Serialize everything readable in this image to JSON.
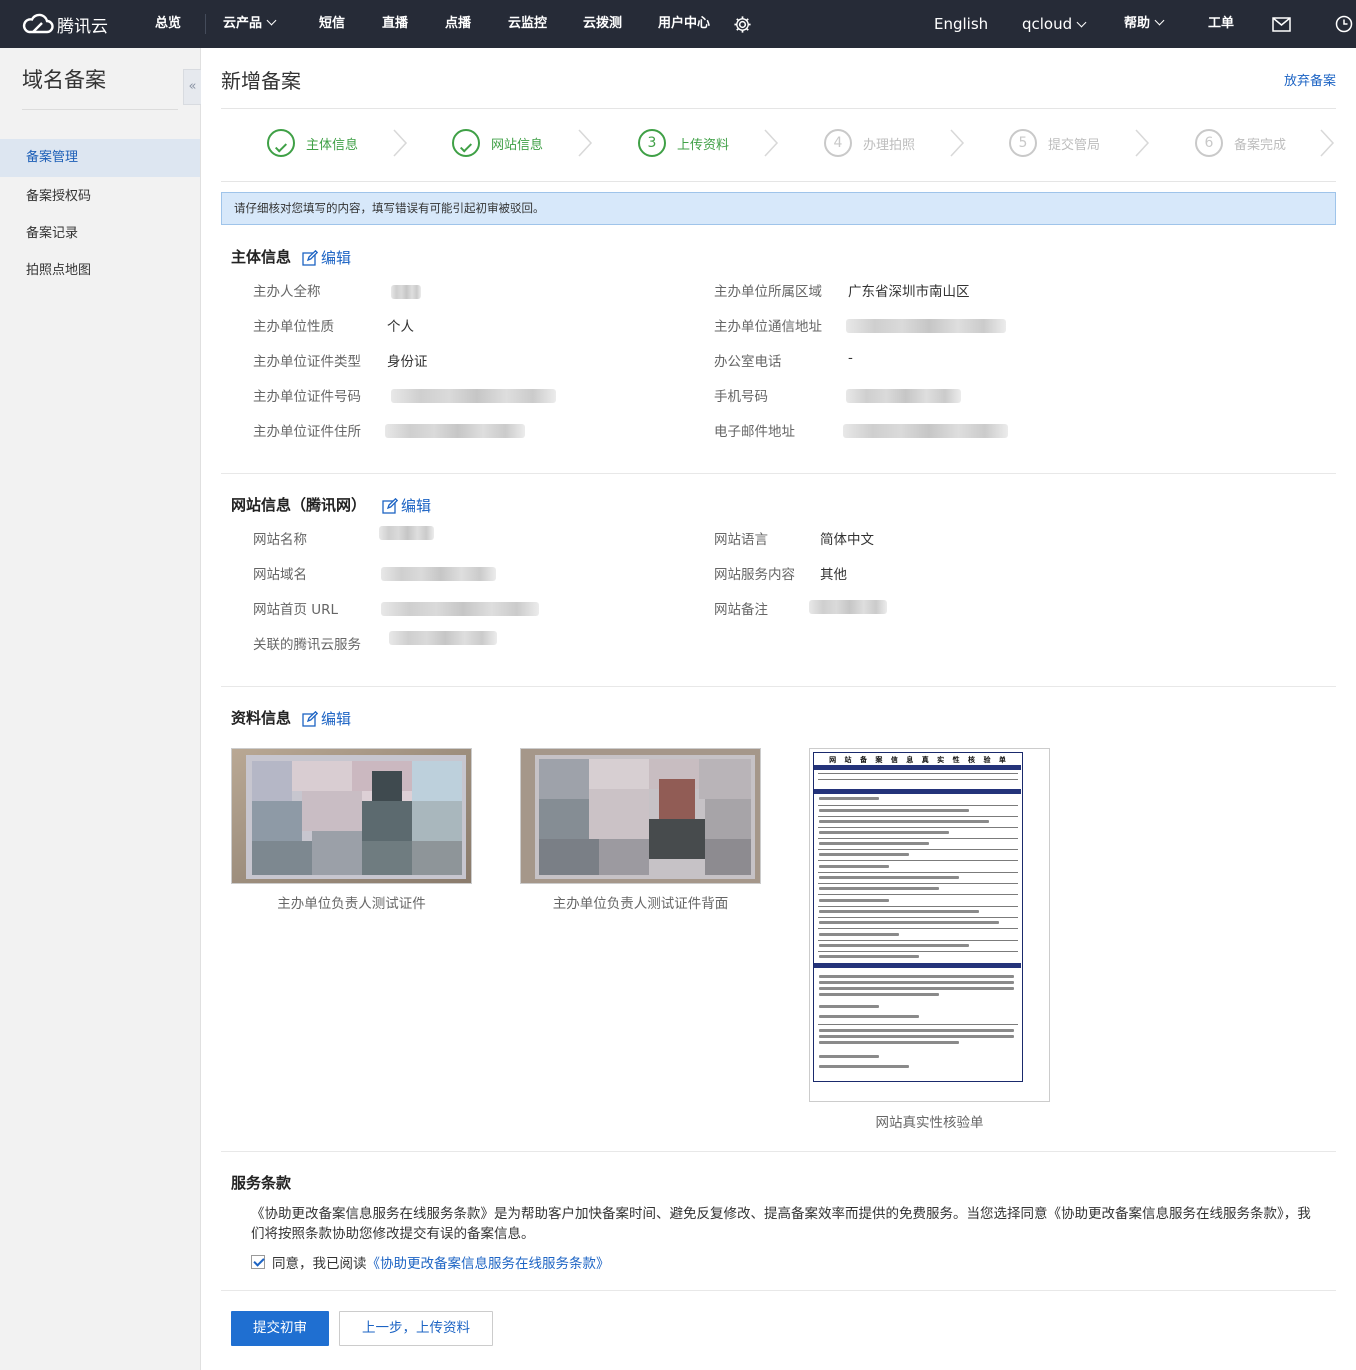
{
  "topnav": {
    "brand": "腾讯云",
    "items": [
      "总览",
      "云产品",
      "短信",
      "直播",
      "点播",
      "云监控",
      "云拨测",
      "用户中心"
    ],
    "right": {
      "language": "English",
      "account": "qcloud",
      "help": "帮助",
      "ticket": "工单"
    }
  },
  "sidebar": {
    "title": "域名备案",
    "collapse": "«",
    "items": [
      "备案管理",
      "备案授权码",
      "备案记录",
      "拍照点地图"
    ]
  },
  "page": {
    "title": "新增备案",
    "abandon": "放弃备案"
  },
  "steps": [
    {
      "num": "",
      "label": "主体信息",
      "status": "done"
    },
    {
      "num": "",
      "label": "网站信息",
      "status": "done"
    },
    {
      "num": "3",
      "label": "上传资料",
      "status": "current"
    },
    {
      "num": "4",
      "label": "办理拍照",
      "status": "todo"
    },
    {
      "num": "5",
      "label": "提交管局",
      "status": "todo"
    },
    {
      "num": "6",
      "label": "备案完成",
      "status": "todo"
    }
  ],
  "notice": "请仔细核对您填写的内容，填写错误有可能引起初审被驳回。",
  "subject": {
    "title": "主体信息",
    "edit": "编辑",
    "left": [
      {
        "label": "主办人全称",
        "value": ""
      },
      {
        "label": "主办单位性质",
        "value": "个人"
      },
      {
        "label": "主办单位证件类型",
        "value": "身份证"
      },
      {
        "label": "主办单位证件号码",
        "value": ""
      },
      {
        "label": "主办单位证件住所",
        "value": ""
      }
    ],
    "right": [
      {
        "label": "主办单位所属区域",
        "value": "广东省深圳市南山区"
      },
      {
        "label": "主办单位通信地址",
        "value": ""
      },
      {
        "label": "办公室电话",
        "value": "-"
      },
      {
        "label": "手机号码",
        "value": ""
      },
      {
        "label": "电子邮件地址",
        "value": ""
      }
    ]
  },
  "website": {
    "title": "网站信息（腾讯网）",
    "edit": "编辑",
    "left": [
      {
        "label": "网站名称",
        "value": ""
      },
      {
        "label": "网站域名",
        "value": ""
      },
      {
        "label": "网站首页 URL",
        "value": ""
      },
      {
        "label": "关联的腾讯云服务",
        "value": ""
      }
    ],
    "right": [
      {
        "label": "网站语言",
        "value": "简体中文"
      },
      {
        "label": "网站服务内容",
        "value": "其他"
      },
      {
        "label": "网站备注",
        "value": ""
      }
    ]
  },
  "materials": {
    "title": "资料信息",
    "edit": "编辑",
    "items": [
      {
        "caption": "主办单位负责人测试证件"
      },
      {
        "caption": "主办单位负责人测试证件背面"
      },
      {
        "caption": "网站真实性核验单"
      }
    ],
    "doc_title": "网 站 备 案 信 息 真 实 性 核 验 单"
  },
  "terms": {
    "title": "服务条款",
    "text": "《协助更改备案信息服务在线服务条款》是为帮助客户加快备案时间、避免反复修改、提高备案效率而提供的免费服务。当您选择同意《协助更改备案信息服务在线服务条款》，我们将按照条款协助您修改提交有误的备案信息。",
    "agree_prefix": "同意，我已阅读",
    "agree_link": "《协助更改备案信息服务在线服务条款》",
    "agreed": true
  },
  "actions": {
    "submit": "提交初审",
    "back": "上一步，上传资料"
  },
  "colors": {
    "nav_bg": "#262b37",
    "link": "#1d64c4",
    "success": "#3fa046",
    "primary_btn": "#1f6fd1",
    "notice_bg": "#d7e8fa"
  }
}
